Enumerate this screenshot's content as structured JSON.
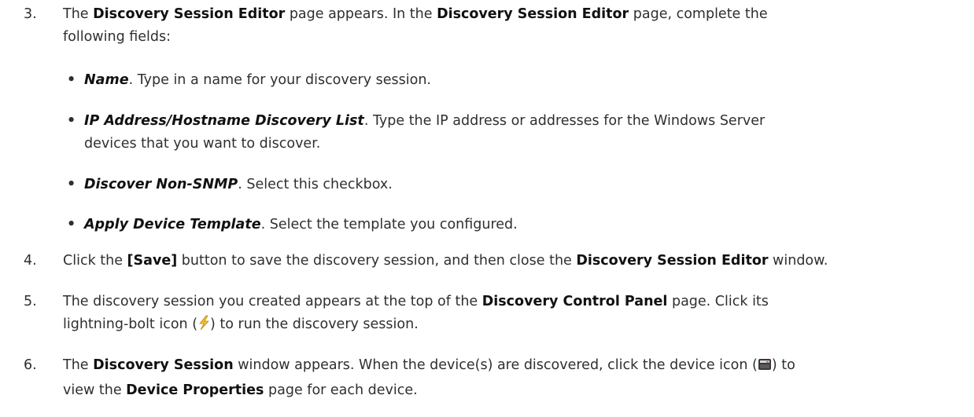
{
  "step3": {
    "number": "3.",
    "t1": "The ",
    "b1": "Discovery Session Editor",
    "t2": " page appears. In the ",
    "b2": "Discovery Session Editor",
    "t3": " page, complete the",
    "line2": "following fields:"
  },
  "bullets": [
    {
      "term": "Name",
      "desc": ". Type in a name for your discovery session."
    },
    {
      "term": "IP Address/Hostname Discovery List",
      "desc": ". Type the IP address or addresses for the Windows Server",
      "desc2": "devices that you want to discover."
    },
    {
      "term": "Discover Non-SNMP",
      "desc": ". Select this checkbox."
    },
    {
      "term": "Apply Device Template",
      "desc": ". Select the template you configured."
    }
  ],
  "step4": {
    "number": "4.",
    "t1": "Click the ",
    "b1": "[Save]",
    "t2": " button to save the discovery session, and then close the ",
    "b2": "Discovery Session Editor",
    "t3": " window."
  },
  "step5": {
    "number": "5.",
    "t1": "The discovery session you created appears at the top of the ",
    "b1": "Discovery Control Panel",
    "t2": " page. Click its",
    "t3": "lightning-bolt icon (",
    "t4": ") to run the discovery session.",
    "icon": "lightning-bolt-icon"
  },
  "step6": {
    "number": "6.",
    "t1": "The ",
    "b1": "Discovery Session",
    "t2": " window appears. When the device(s) are discovered, click the device icon (",
    "t3": ") to",
    "t4": "view the ",
    "b2": "Device Properties",
    "t5": " page for each device.",
    "icon": "device-icon"
  },
  "colors": {
    "text": "#2f2f2f",
    "bold": "#111111",
    "bolt": "#f2c12e",
    "device": "#3a3a3a"
  }
}
